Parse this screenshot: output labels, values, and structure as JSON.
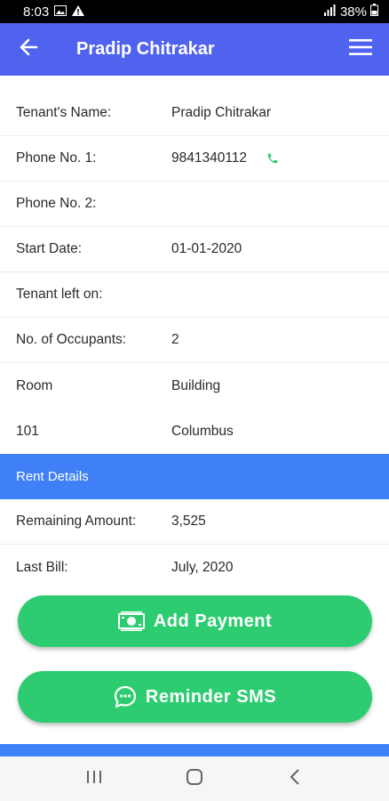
{
  "status_bar": {
    "time": "8:03",
    "battery": "38%"
  },
  "app_bar": {
    "title": "Pradip Chitrakar"
  },
  "details": [
    {
      "label": "Tenant's Name:",
      "value": "Pradip Chitrakar"
    },
    {
      "label": "Phone No. 1:",
      "value": "9841340112"
    },
    {
      "label": "Phone No. 2:",
      "value": ""
    },
    {
      "label": "Start Date:",
      "value": "01-01-2020"
    },
    {
      "label": "Tenant left on:",
      "value": ""
    },
    {
      "label": "No. of Occupants:",
      "value": "2"
    }
  ],
  "room": {
    "header_left": "Room",
    "header_right": "Building",
    "room_value": "101",
    "building_value": "Columbus"
  },
  "rent_section": {
    "title": "Rent Details",
    "items": [
      {
        "label": "Remaining Amount:",
        "value": "3,525"
      },
      {
        "label": "Last Bill:",
        "value": "July, 2020"
      }
    ]
  },
  "buttons": {
    "add_payment": "Add Payment",
    "reminder_sms": "Reminder SMS"
  },
  "colors": {
    "app_bar": "#4f63ee",
    "section": "#3f80f7",
    "button": "#2ecc71",
    "phone_icon": "#2ecc71"
  },
  "icons": {
    "back": "arrow-left-icon",
    "menu": "hamburger-menu-icon",
    "phone": "phone-icon",
    "payment": "money-icon",
    "sms": "chat-bubble-icon"
  }
}
